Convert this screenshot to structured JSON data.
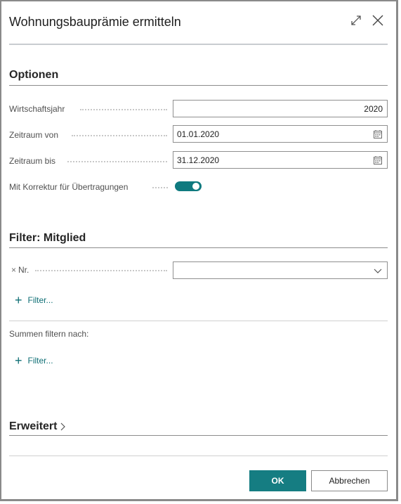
{
  "dialog": {
    "title": "Wohnungsbauprämie ermitteln",
    "expand_icon": "expand-icon",
    "close_icon": "close-icon"
  },
  "options": {
    "heading": "Optionen",
    "fiscal_year_label": "Wirtschaftsjahr",
    "fiscal_year_value": "2020",
    "period_from_label": "Zeitraum von",
    "period_from_value": "01.01.2020",
    "period_to_label": "Zeitraum bis",
    "period_to_value": "31.12.2020",
    "correction_label": "Mit Korrektur für Übertragungen",
    "correction_enabled": true
  },
  "filter": {
    "heading": "Filter: Mitglied",
    "remove_symbol": "×",
    "nr_label": "Nr.",
    "nr_value": "",
    "add_filter_label": "Filter...",
    "sum_filter_label": "Summen filtern nach:",
    "sum_add_filter_label": "Filter..."
  },
  "advanced": {
    "heading": "Erweitert"
  },
  "footer": {
    "ok_label": "OK",
    "cancel_label": "Abbrechen"
  },
  "colors": {
    "accent": "#157d82",
    "link": "#0f6f75"
  }
}
